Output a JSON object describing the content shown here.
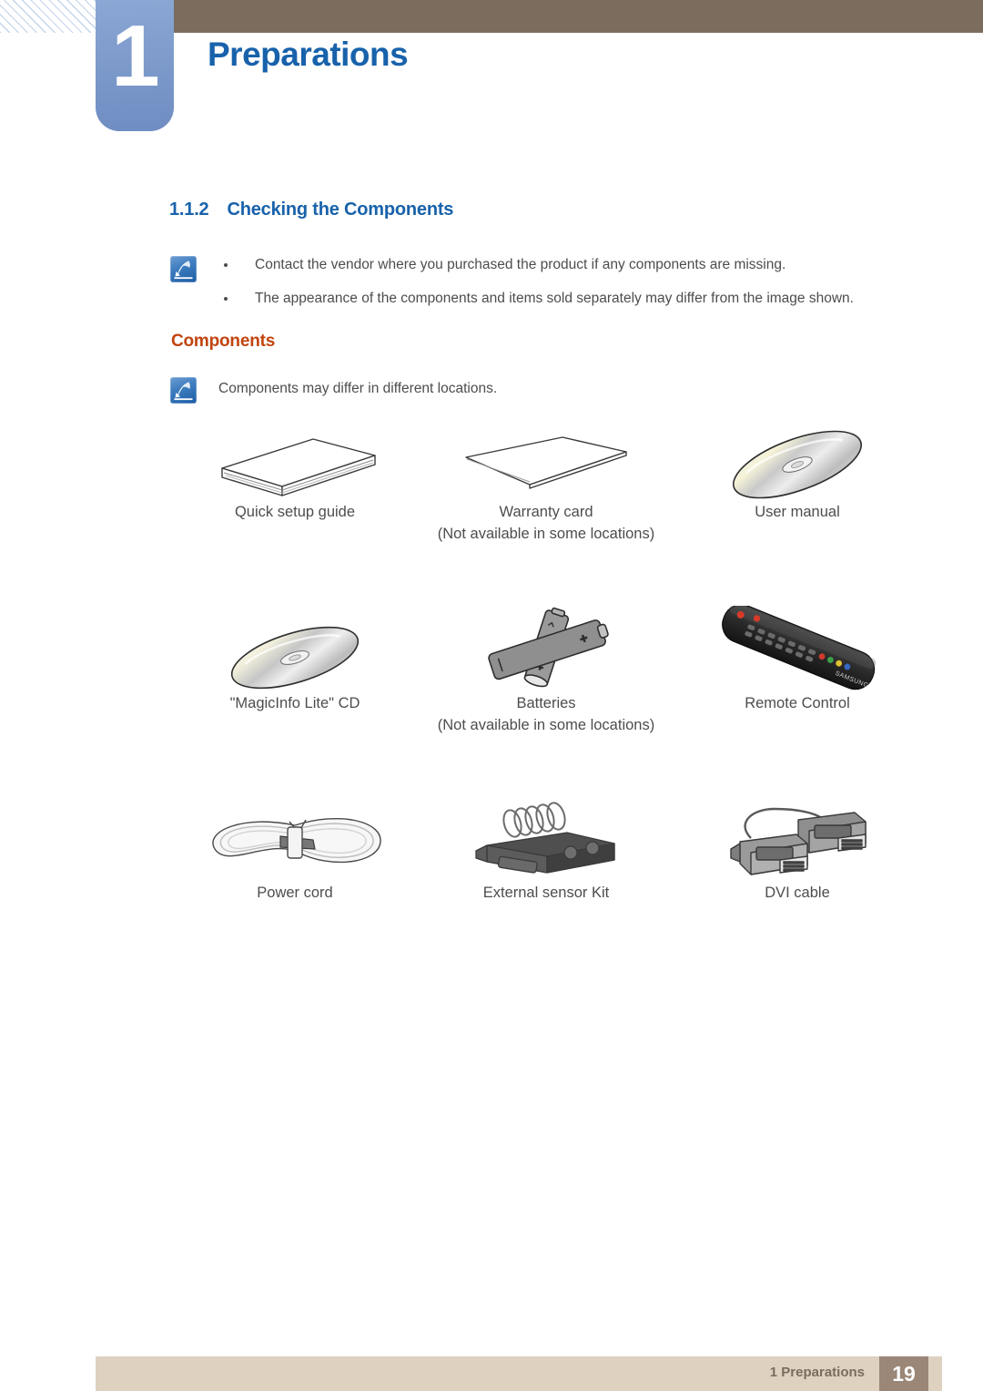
{
  "header": {
    "chapter_number": "1",
    "chapter_title": "Preparations",
    "accent_blue": "#1862ab",
    "tab_blue": "#7e9bcc",
    "bar_brown": "#7b6c5d"
  },
  "section": {
    "number": "1.1.2",
    "title": "Checking the Components"
  },
  "top_note": {
    "icon": "note-pen-icon",
    "bullets": [
      "Contact the vendor where you purchased the product if any components are missing.",
      "The appearance of the components and items sold separately may differ from the image shown."
    ]
  },
  "components_heading": {
    "label": "Components",
    "color": "#c1440e"
  },
  "components_note": {
    "icon": "note-pen-icon",
    "text": "Components may differ in different locations."
  },
  "components": [
    {
      "icon": "booklet-icon",
      "label": "Quick setup guide",
      "sublabel": ""
    },
    {
      "icon": "card-sheet-icon",
      "label": "Warranty card",
      "sublabel": "(Not available in some locations)"
    },
    {
      "icon": "cd-disc-icon",
      "label": "User manual",
      "sublabel": ""
    },
    {
      "icon": "cd-disc-icon",
      "label": "\"MagicInfo Lite\" CD",
      "sublabel": ""
    },
    {
      "icon": "batteries-icon",
      "label": "Batteries",
      "sublabel": "(Not available in some locations)"
    },
    {
      "icon": "remote-control-icon",
      "label": "Remote Control",
      "sublabel": ""
    },
    {
      "icon": "power-cord-icon",
      "label": "Power cord",
      "sublabel": ""
    },
    {
      "icon": "external-sensor-kit-icon",
      "label": "External sensor Kit",
      "sublabel": ""
    },
    {
      "icon": "dvi-cable-icon",
      "label": "DVI cable",
      "sublabel": ""
    }
  ],
  "footer": {
    "label": "1 Preparations",
    "page_number": "19",
    "bar_color": "#ded1c0",
    "page_box_color": "#9b8778"
  }
}
